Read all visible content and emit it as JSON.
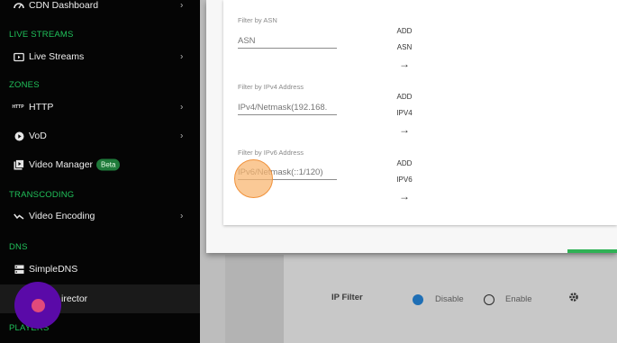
{
  "sidebar": {
    "items": [
      {
        "label": "CDN Dashboard",
        "icon": "gauge-icon",
        "chevron": "›"
      },
      {
        "section": "LIVE STREAMS"
      },
      {
        "label": "Live Streams",
        "icon": "live-tv-icon",
        "chevron": "›"
      },
      {
        "section": "ZONES"
      },
      {
        "label": "HTTP",
        "icon": "http-icon",
        "icon_text": "HTTP",
        "chevron": "›"
      },
      {
        "label": "VoD",
        "icon": "play-circle-icon",
        "chevron": "›"
      },
      {
        "label": "Video Manager",
        "icon": "video-library-icon",
        "badge": "Beta"
      },
      {
        "section": "TRANSCODING"
      },
      {
        "label": "Video Encoding",
        "icon": "encoding-icon",
        "chevron": "›"
      },
      {
        "section": "DNS"
      },
      {
        "label": "SimpleDNS",
        "icon": "dns-icon"
      },
      {
        "label": "irector",
        "icon": "director-icon"
      },
      {
        "section": "PLAYERS"
      }
    ]
  },
  "modal": {
    "filters": [
      {
        "label": "Filter by ASN",
        "placeholder": "ASN",
        "add": "ADD",
        "type": "ASN",
        "arrow": "→"
      },
      {
        "label": "Filter by IPv4 Address",
        "placeholder": "IPv4/Netmask(192.168.",
        "add": "ADD",
        "type": "IPV4",
        "arrow": "→"
      },
      {
        "label": "Filter by IPv6 Address",
        "placeholder": "IPv6/Netmask(::1/120)",
        "add": "ADD",
        "type": "IPV6",
        "arrow": "→"
      }
    ]
  },
  "background": {
    "ip_filter_label": "IP Filter",
    "disable_label": "Disable",
    "enable_label": "Enable",
    "selected": "Disable",
    "settings_icon": "gear-icon"
  },
  "colors": {
    "accent_green": "#20c05a",
    "radio_blue": "#1f6fb5",
    "touch_orange": "#f0913a",
    "touch_purple": "#5a0aa8"
  }
}
